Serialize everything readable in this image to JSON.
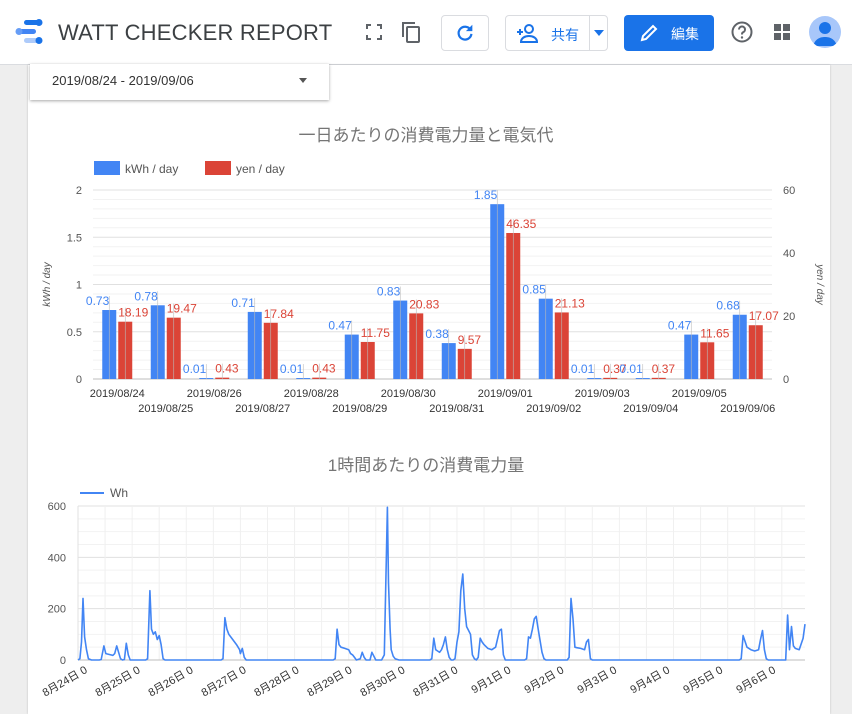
{
  "header": {
    "app_title": "WATT CHECKER REPORT",
    "share_label": "共有",
    "edit_label": "編集"
  },
  "date_range": {
    "value": "2019/08/24 - 2019/09/06"
  },
  "chart1": {
    "title": "一日あたりの消費電力量と電気代"
  },
  "chart2": {
    "title": "1時間あたりの消費電力量"
  },
  "colors": {
    "blue": "#4285f4",
    "red": "#db4437",
    "accent": "#1a73e8"
  },
  "chart_data": [
    {
      "type": "bar",
      "title": "一日あたりの消費電力量と電気代",
      "categories": [
        "2019/08/24",
        "2019/08/25",
        "2019/08/26",
        "2019/08/27",
        "2019/08/28",
        "2019/08/29",
        "2019/08/30",
        "2019/08/31",
        "2019/09/01",
        "2019/09/02",
        "2019/09/03",
        "2019/09/04",
        "2019/09/05",
        "2019/09/06"
      ],
      "series": [
        {
          "name": "kWh / day",
          "axis": "left",
          "color": "#4285f4",
          "values": [
            0.73,
            0.78,
            0.01,
            0.71,
            0.01,
            0.47,
            0.83,
            0.38,
            1.85,
            0.85,
            0.01,
            0.01,
            0.47,
            0.68
          ],
          "labels": [
            "0.73",
            "0.78",
            "0.01",
            "0.71",
            "0.01",
            "0.47",
            "0.83",
            "0.38",
            "1.85",
            "0.85",
            "0.01",
            "0.01",
            "0.47",
            "0.68"
          ]
        },
        {
          "name": "yen / day",
          "axis": "right",
          "color": "#db4437",
          "values": [
            18.19,
            19.47,
            0.43,
            17.84,
            0.43,
            11.75,
            20.83,
            9.57,
            46.35,
            21.13,
            0.37,
            0.37,
            11.65,
            17.07
          ],
          "labels": [
            "18.19",
            "19.47",
            "0.43",
            "17.84",
            "0.43",
            "11.75",
            "20.83",
            "9.57",
            "46.35",
            "21.13",
            "0.37",
            "0.37",
            "11.65",
            "17.07"
          ]
        }
      ],
      "ylabel": "kWh / day",
      "y2label": "yen / day",
      "ylim": [
        0,
        2
      ],
      "y2lim": [
        0,
        60
      ],
      "yticks": [
        "0",
        "0.5",
        "1",
        "1.5",
        "2"
      ],
      "y2ticks": [
        "0",
        "20",
        "40",
        "60"
      ],
      "legend": "top-left",
      "grid": true
    },
    {
      "type": "line",
      "title": "1時間あたりの消費電力量",
      "series": [
        {
          "name": "Wh",
          "color": "#4285f4",
          "points": [
            [
              0,
              0
            ],
            [
              0.05,
              5
            ],
            [
              0.09,
              70
            ],
            [
              0.13,
              240
            ],
            [
              0.17,
              90
            ],
            [
              0.22,
              40
            ],
            [
              0.27,
              5
            ],
            [
              0.35,
              0
            ],
            [
              0.45,
              0
            ],
            [
              0.55,
              0
            ],
            [
              0.6,
              2
            ],
            [
              0.67,
              55
            ],
            [
              0.72,
              25
            ],
            [
              0.85,
              20
            ],
            [
              0.9,
              18
            ],
            [
              0.95,
              25
            ],
            [
              1.0,
              55
            ],
            [
              1.05,
              30
            ],
            [
              1.1,
              5
            ],
            [
              1.15,
              0
            ],
            [
              1.2,
              2
            ],
            [
              1.25,
              65
            ],
            [
              1.3,
              20
            ],
            [
              1.35,
              0
            ],
            [
              1.75,
              0
            ],
            [
              1.8,
              5
            ],
            [
              1.86,
              270
            ],
            [
              1.9,
              120
            ],
            [
              1.95,
              100
            ],
            [
              2.0,
              110
            ],
            [
              2.05,
              80
            ],
            [
              2.1,
              95
            ],
            [
              2.15,
              60
            ],
            [
              2.2,
              5
            ],
            [
              2.25,
              0
            ],
            [
              3.0,
              0
            ],
            [
              3.5,
              0
            ],
            [
              3.7,
              0
            ],
            [
              3.75,
              5
            ],
            [
              3.8,
              165
            ],
            [
              3.85,
              120
            ],
            [
              3.9,
              100
            ],
            [
              4.0,
              80
            ],
            [
              4.1,
              60
            ],
            [
              4.18,
              40
            ],
            [
              4.2,
              25
            ],
            [
              4.25,
              45
            ],
            [
              4.3,
              10
            ],
            [
              4.35,
              0
            ],
            [
              5.0,
              0
            ],
            [
              5.5,
              0
            ],
            [
              6.0,
              0
            ],
            [
              6.5,
              0
            ],
            [
              6.6,
              0
            ],
            [
              6.65,
              5
            ],
            [
              6.7,
              120
            ],
            [
              6.75,
              60
            ],
            [
              6.8,
              50
            ],
            [
              6.9,
              45
            ],
            [
              7.0,
              40
            ],
            [
              7.05,
              25
            ],
            [
              7.1,
              20
            ],
            [
              7.15,
              10
            ],
            [
              7.2,
              0
            ],
            [
              7.3,
              5
            ],
            [
              7.35,
              30
            ],
            [
              7.4,
              10
            ],
            [
              7.45,
              0
            ],
            [
              7.55,
              0
            ],
            [
              7.6,
              30
            ],
            [
              7.7,
              0
            ],
            [
              7.85,
              0
            ],
            [
              7.92,
              20
            ],
            [
              8.0,
              595
            ],
            [
              8.03,
              300
            ],
            [
              8.07,
              120
            ],
            [
              8.1,
              40
            ],
            [
              8.15,
              15
            ],
            [
              8.2,
              5
            ],
            [
              8.3,
              0
            ],
            [
              8.8,
              0
            ],
            [
              9.0,
              0
            ],
            [
              9.1,
              0
            ],
            [
              9.15,
              5
            ],
            [
              9.2,
              85
            ],
            [
              9.25,
              40
            ],
            [
              9.3,
              35
            ],
            [
              9.35,
              30
            ],
            [
              9.4,
              40
            ],
            [
              9.45,
              60
            ],
            [
              9.5,
              90
            ],
            [
              9.55,
              40
            ],
            [
              9.6,
              10
            ],
            [
              9.65,
              0
            ],
            [
              9.7,
              0
            ],
            [
              9.75,
              5
            ],
            [
              9.8,
              70
            ],
            [
              9.85,
              110
            ],
            [
              9.9,
              270
            ],
            [
              9.95,
              335
            ],
            [
              10.0,
              200
            ],
            [
              10.05,
              130
            ],
            [
              10.1,
              115
            ],
            [
              10.15,
              100
            ],
            [
              10.2,
              20
            ],
            [
              10.25,
              5
            ],
            [
              10.3,
              0
            ],
            [
              10.35,
              10
            ],
            [
              10.4,
              85
            ],
            [
              10.45,
              70
            ],
            [
              10.5,
              60
            ],
            [
              10.6,
              45
            ],
            [
              10.7,
              40
            ],
            [
              10.8,
              50
            ],
            [
              10.9,
              115
            ],
            [
              10.95,
              120
            ],
            [
              11.0,
              20
            ],
            [
              11.05,
              0
            ],
            [
              11.5,
              0
            ],
            [
              11.55,
              0
            ],
            [
              11.6,
              5
            ],
            [
              11.65,
              90
            ],
            [
              11.7,
              85
            ],
            [
              11.75,
              120
            ],
            [
              11.8,
              160
            ],
            [
              11.85,
              170
            ],
            [
              11.9,
              120
            ],
            [
              12.0,
              30
            ],
            [
              12.05,
              5
            ],
            [
              12.1,
              0
            ],
            [
              12.65,
              0
            ],
            [
              12.7,
              10
            ],
            [
              12.75,
              240
            ],
            [
              12.8,
              160
            ],
            [
              12.85,
              50
            ],
            [
              12.9,
              48
            ],
            [
              13.0,
              45
            ],
            [
              13.1,
              40
            ],
            [
              13.15,
              70
            ],
            [
              13.2,
              80
            ],
            [
              13.25,
              5
            ],
            [
              13.3,
              0
            ],
            [
              13.5,
              0
            ],
            [
              14.0,
              0
            ],
            [
              14.5,
              0
            ],
            [
              15.0,
              0
            ],
            [
              15.5,
              0
            ],
            [
              16.0,
              0
            ],
            [
              16.5,
              0
            ],
            [
              17.0,
              0
            ],
            [
              17.1,
              0
            ],
            [
              17.15,
              5
            ],
            [
              17.2,
              95
            ],
            [
              17.3,
              50
            ],
            [
              17.4,
              40
            ],
            [
              17.5,
              35
            ],
            [
              17.6,
              40
            ],
            [
              17.65,
              80
            ],
            [
              17.7,
              115
            ],
            [
              17.75,
              40
            ],
            [
              17.8,
              5
            ],
            [
              17.85,
              0
            ],
            [
              18.0,
              0
            ],
            [
              18.3,
              0
            ],
            [
              18.35,
              175
            ],
            [
              18.4,
              40
            ],
            [
              18.45,
              130
            ],
            [
              18.5,
              55
            ],
            [
              18.55,
              45
            ],
            [
              18.65,
              40
            ],
            [
              18.75,
              85
            ],
            [
              18.8,
              140
            ]
          ]
        }
      ],
      "xticks": [
        "8月24日 0",
        "8月25日 0",
        "8月26日 0",
        "8月27日 0",
        "8月28日 0",
        "8月29日 0",
        "8月30日 0",
        "8月31日 0",
        "9月1日 0",
        "9月2日 0",
        "9月3日 0",
        "9月4日 0",
        "9月5日 0",
        "9月6日 0"
      ],
      "yticks": [
        "0",
        "200",
        "400",
        "600"
      ],
      "ylim": [
        0,
        600
      ],
      "legend": "top-left",
      "grid": true
    }
  ]
}
